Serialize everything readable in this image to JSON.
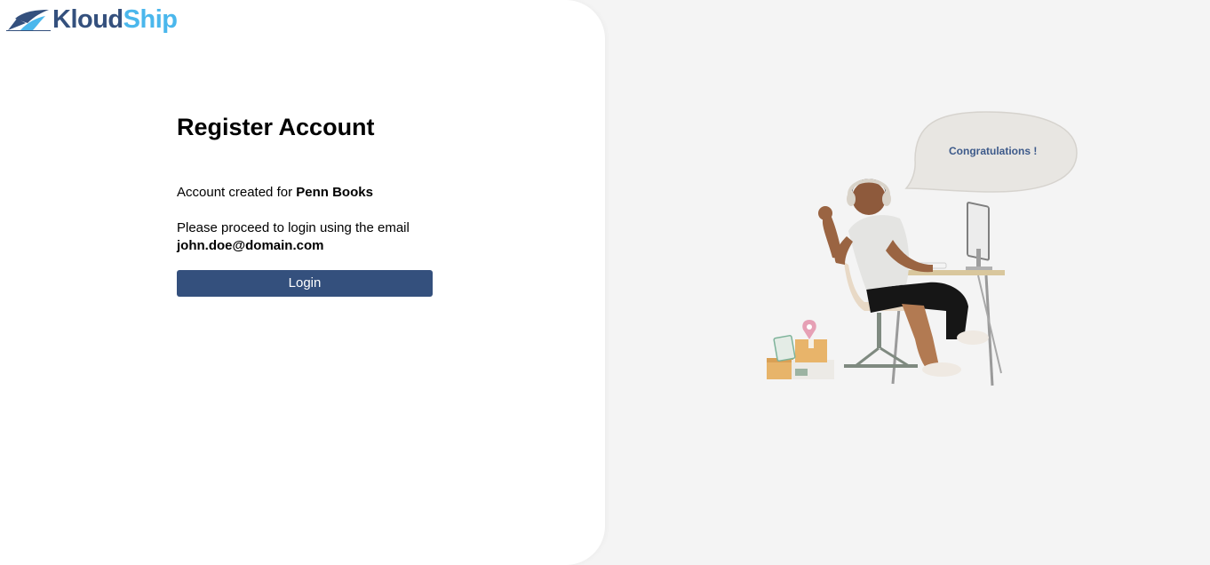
{
  "logo": {
    "part1": "Kloud",
    "part2": "Ship"
  },
  "register": {
    "title": "Register Account",
    "created_prefix": "Account created for ",
    "company": "Penn Books",
    "proceed_text": "Please proceed to login using the email",
    "email": "john.doe@domain.com",
    "login_label": "Login"
  },
  "bubble": {
    "text": "Congratulations !"
  },
  "colors": {
    "brand_dark": "#34507d",
    "brand_light": "#4ab7ec",
    "bubble_text": "#3d5a8a"
  }
}
